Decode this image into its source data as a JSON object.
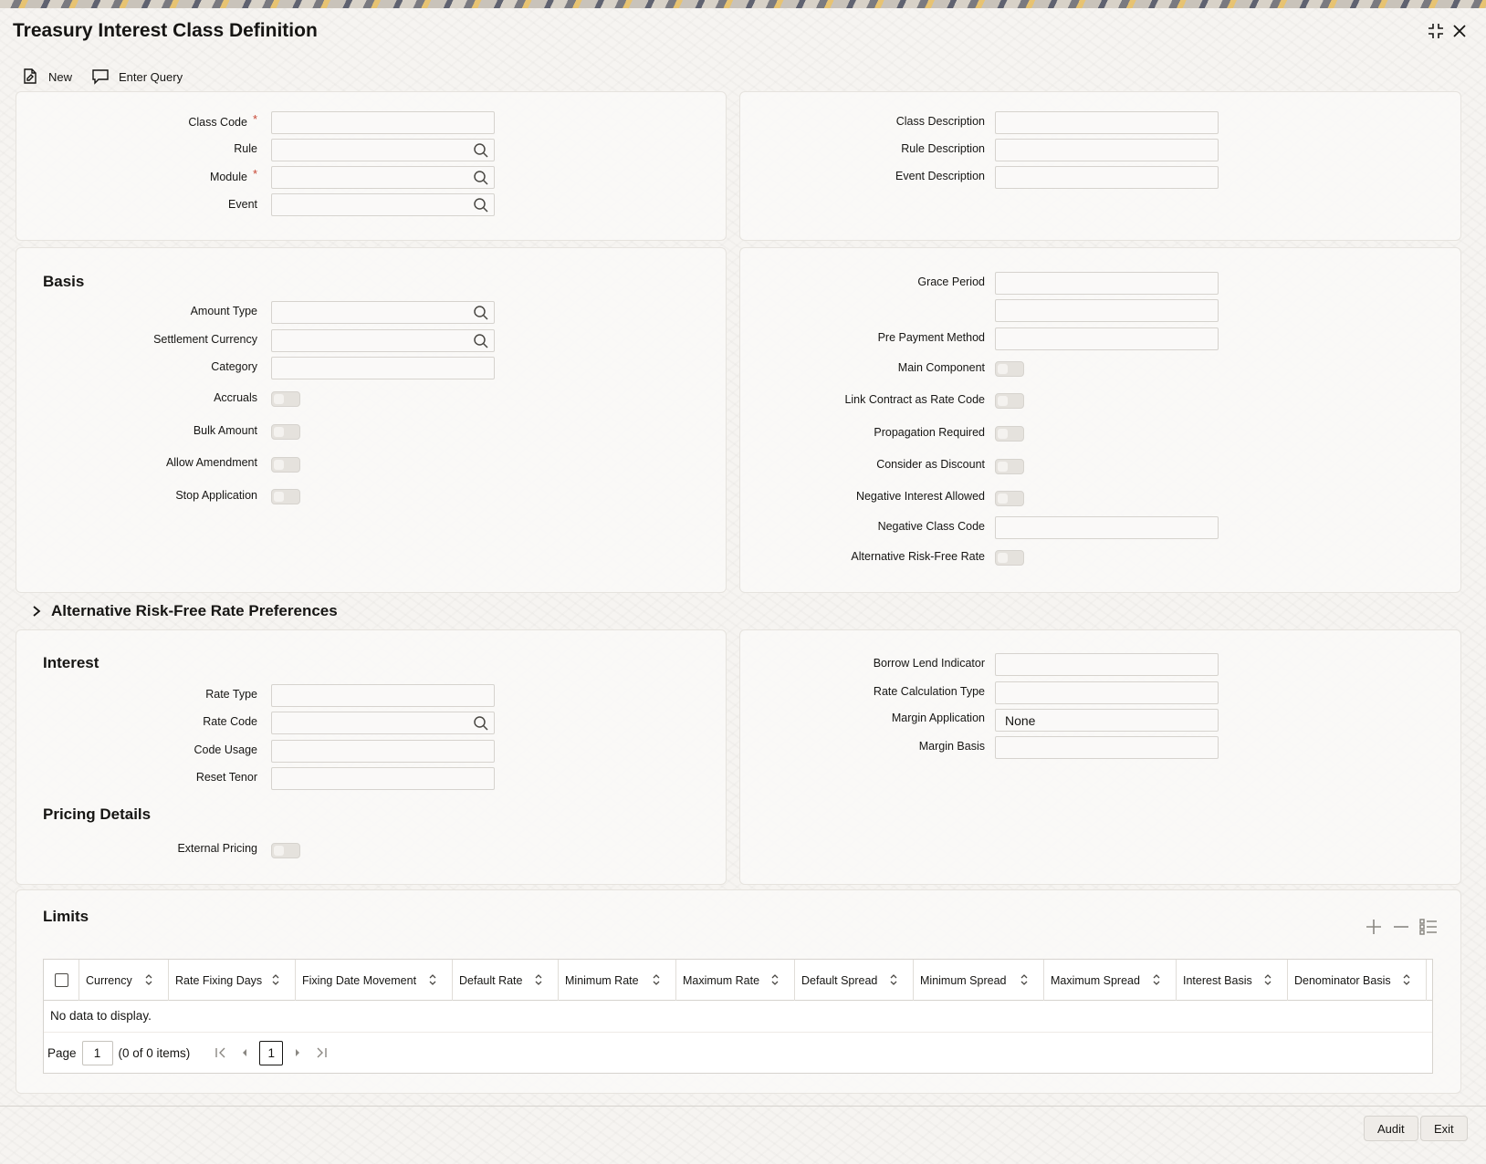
{
  "window": {
    "title": "Treasury Interest Class Definition"
  },
  "toolbar": {
    "new_label": "New",
    "enter_query_label": "Enter Query"
  },
  "header": {
    "class_code": "Class Code",
    "rule": "Rule",
    "module": "Module",
    "event": "Event",
    "required_mark": "*",
    "class_description": "Class Description",
    "rule_description": "Rule Description",
    "event_description": "Event Description"
  },
  "basis": {
    "title": "Basis",
    "amount_type": "Amount Type",
    "settlement_currency": "Settlement Currency",
    "category": "Category",
    "accruals": "Accruals",
    "bulk_amount": "Bulk Amount",
    "allow_amendment": "Allow Amendment",
    "stop_application": "Stop Application"
  },
  "basis_right": {
    "grace_period": "Grace Period",
    "pre_payment_method": "Pre Payment Method",
    "main_component": "Main Component",
    "link_contract": "Link Contract as Rate Code",
    "propagation_required": "Propagation Required",
    "consider_discount": "Consider as Discount",
    "negative_interest": "Negative Interest Allowed",
    "negative_class_code": "Negative Class Code",
    "alt_risk_free_rate": "Alternative Risk-Free Rate"
  },
  "arfr_section": {
    "title": "Alternative Risk-Free Rate Preferences"
  },
  "interest": {
    "title": "Interest",
    "rate_type": "Rate Type",
    "rate_code": "Rate Code",
    "code_usage": "Code Usage",
    "reset_tenor": "Reset Tenor",
    "borrow_lend": "Borrow Lend Indicator",
    "rate_calc_type": "Rate Calculation Type",
    "margin_application": "Margin Application",
    "margin_application_value": "None",
    "margin_basis": "Margin Basis"
  },
  "pricing": {
    "title": "Pricing Details",
    "external_pricing": "External Pricing"
  },
  "limits": {
    "title": "Limits",
    "columns": [
      "Currency",
      "Rate Fixing Days",
      "Fixing Date Movement",
      "Default Rate",
      "Minimum Rate",
      "Maximum Rate",
      "Default Spread",
      "Minimum Spread",
      "Maximum Spread",
      "Interest Basis",
      "Denominator Basis"
    ],
    "no_data": "No data to display.",
    "page_label": "Page",
    "page_value": "1",
    "items_text": "(0 of 0 items)",
    "current_page": "1"
  },
  "footer": {
    "audit_label": "Audit",
    "exit_label": "Exit"
  },
  "colors": {
    "required": "#c74634",
    "background": "#f6f4f1",
    "border": "#d6d3ce"
  },
  "icons": [
    "maximize-icon",
    "close-icon",
    "new-document-icon",
    "enter-query-icon",
    "search-icon",
    "chevron-right-icon",
    "add-icon",
    "remove-icon",
    "column-settings-icon",
    "sort-icon",
    "first-page-icon",
    "previous-page-icon",
    "next-page-icon",
    "last-page-icon"
  ]
}
